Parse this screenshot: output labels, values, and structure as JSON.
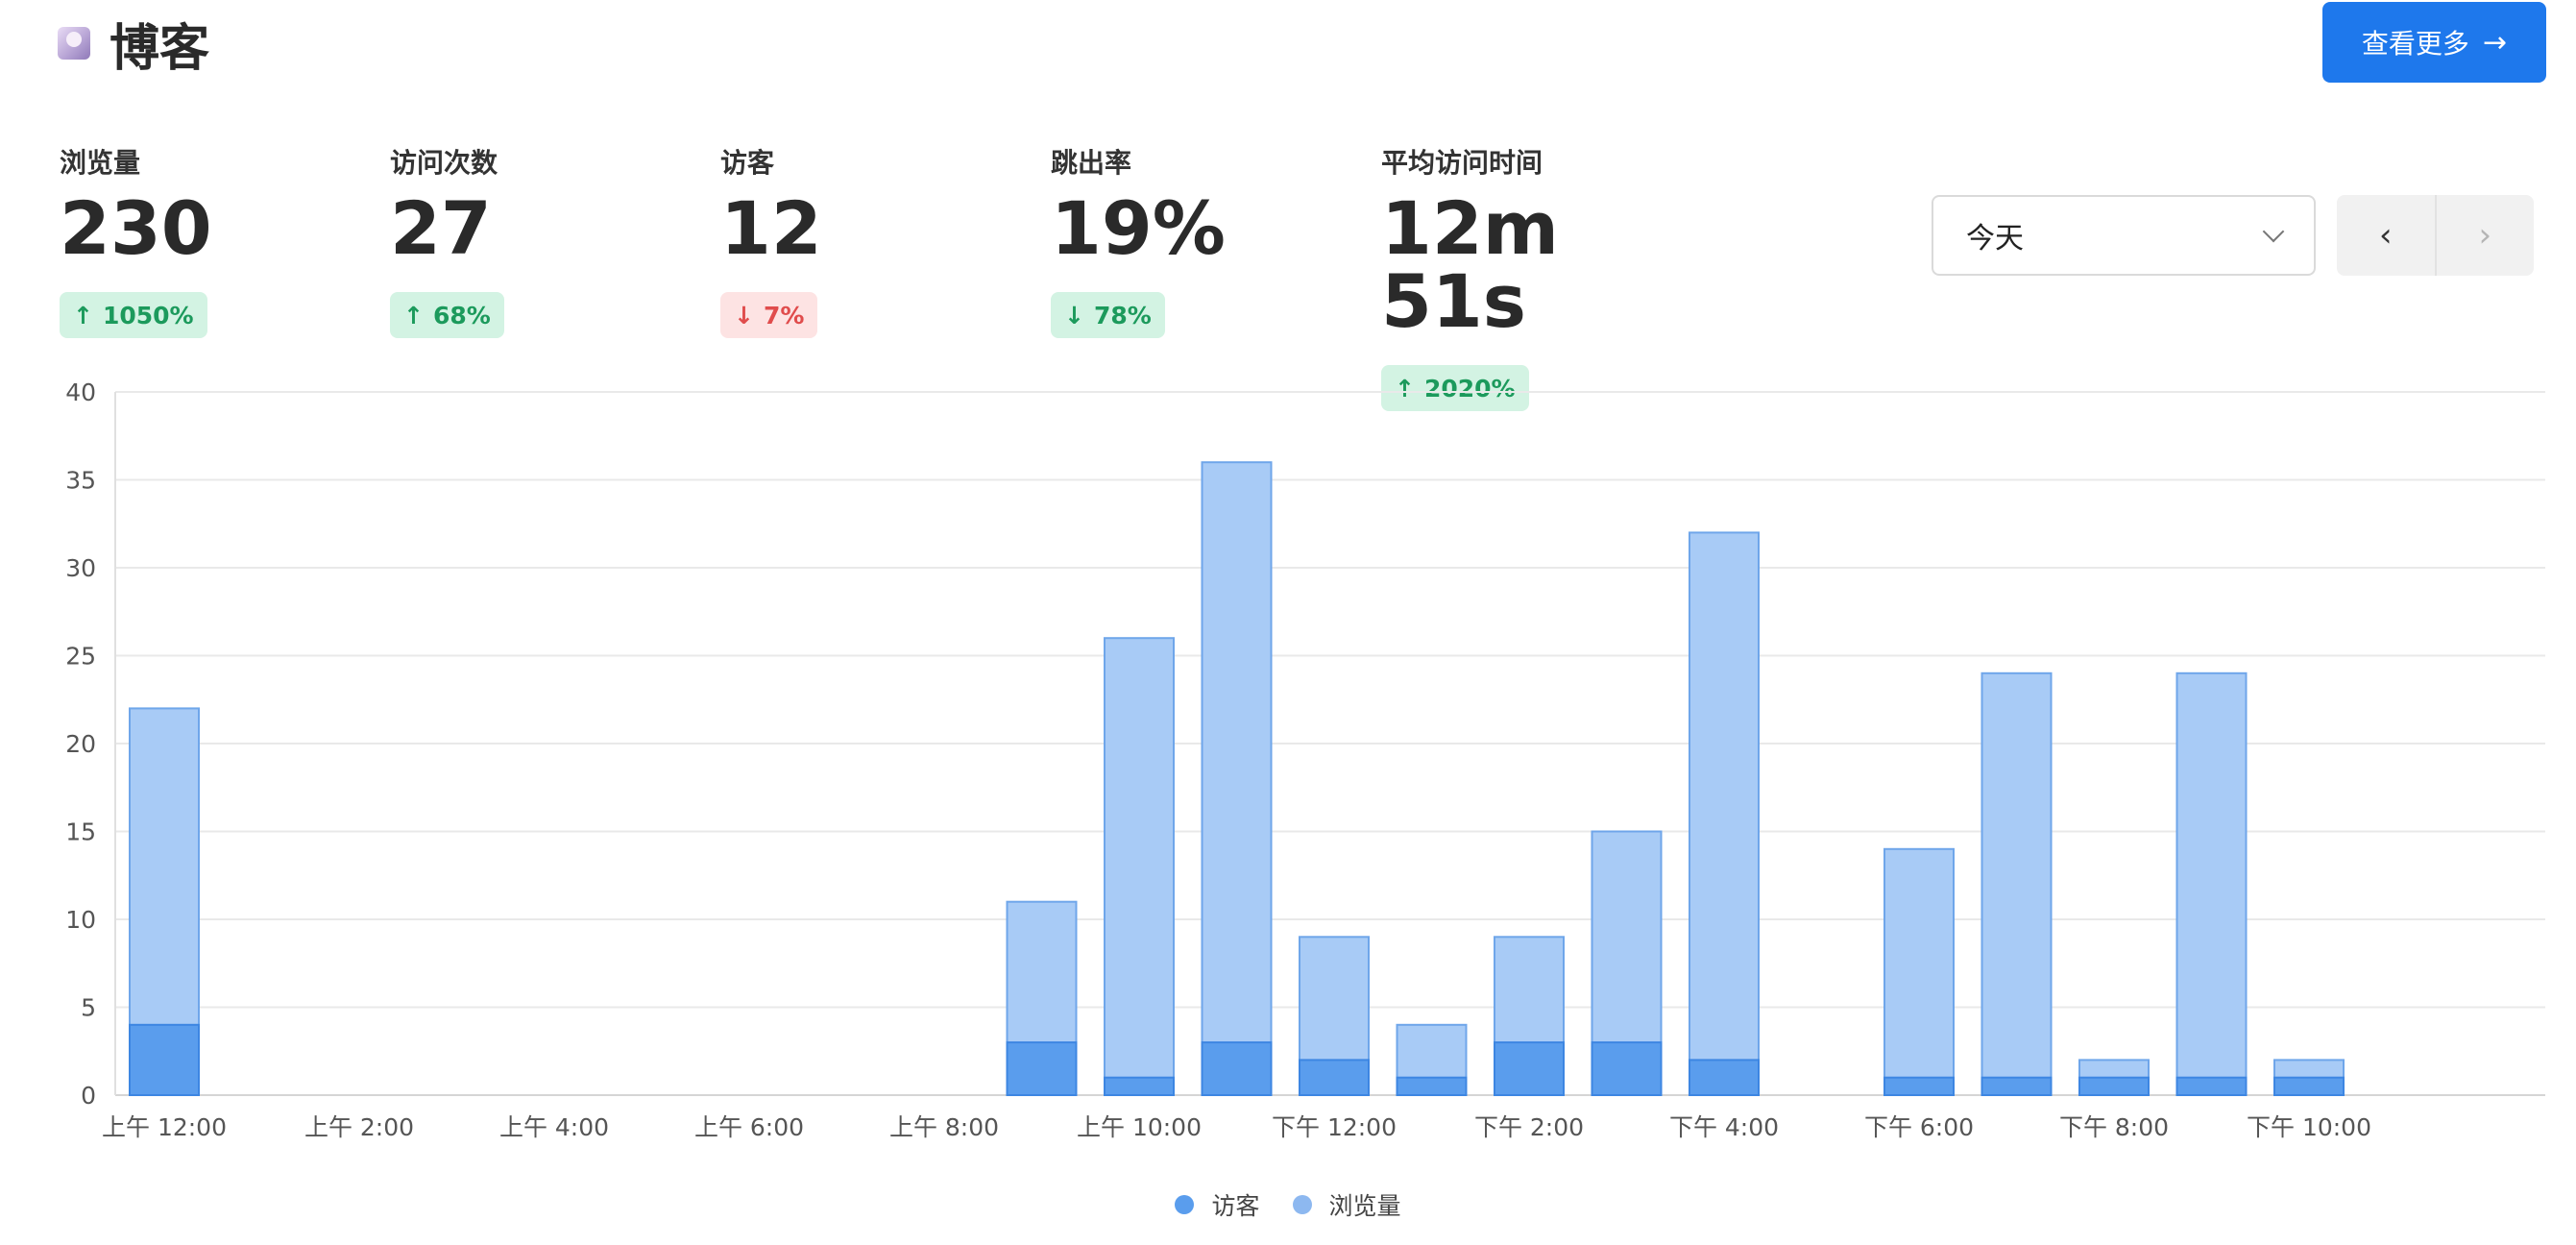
{
  "header": {
    "site_title": "博客",
    "view_more_label": "查看更多",
    "view_more_arrow": "→"
  },
  "metrics": [
    {
      "label": "浏览量",
      "value": "230",
      "change": "1050%",
      "direction": "up"
    },
    {
      "label": "访问次数",
      "value": "27",
      "change": "68%",
      "direction": "up"
    },
    {
      "label": "访客",
      "value": "12",
      "change": "7%",
      "direction": "down"
    },
    {
      "label": "跳出率",
      "value": "19%",
      "change": "78%",
      "direction": "down-good"
    },
    {
      "label": "平均访问时间",
      "value": "12m 51s",
      "change": "2020%",
      "direction": "up"
    }
  ],
  "controls": {
    "range_value": "今天",
    "prev_icon": "‹",
    "next_icon": "›"
  },
  "colors": {
    "accent": "#1e78ec",
    "visitors": "#5a9ded",
    "pageviews": "#a8cbf6",
    "positive": "#1c9a5c",
    "negative": "#e04c4c"
  },
  "chart_data": {
    "type": "bar",
    "stacked_overlay": true,
    "categories": [
      "上午 12:00",
      "上午 1:00",
      "上午 2:00",
      "上午 3:00",
      "上午 4:00",
      "上午 5:00",
      "上午 6:00",
      "上午 7:00",
      "上午 8:00",
      "上午 9:00",
      "上午 10:00",
      "上午 11:00",
      "下午 12:00",
      "下午 1:00",
      "下午 2:00",
      "下午 3:00",
      "下午 4:00",
      "下午 5:00",
      "下午 6:00",
      "下午 7:00",
      "下午 8:00",
      "下午 9:00",
      "下午 10:00",
      "下午 11:00"
    ],
    "x_tick_labels": [
      "上午 12:00",
      "上午 2:00",
      "上午 4:00",
      "上午 6:00",
      "上午 8:00",
      "上午 10:00",
      "下午 12:00",
      "下午 2:00",
      "下午 4:00",
      "下午 6:00",
      "下午 8:00",
      "下午 10:00"
    ],
    "series": [
      {
        "name": "访客",
        "values": [
          4,
          0,
          0,
          0,
          0,
          0,
          0,
          0,
          0,
          3,
          1,
          3,
          2,
          1,
          3,
          3,
          2,
          0,
          1,
          1,
          1,
          1,
          1,
          0
        ]
      },
      {
        "name": "浏览量",
        "values": [
          22,
          0,
          0,
          0,
          0,
          0,
          0,
          0,
          0,
          11,
          26,
          36,
          9,
          4,
          9,
          15,
          32,
          0,
          14,
          24,
          2,
          24,
          2,
          0
        ]
      }
    ],
    "ylim": [
      0,
      40
    ],
    "y_ticks": [
      0,
      5,
      10,
      15,
      20,
      25,
      30,
      35,
      40
    ],
    "grid": true,
    "legend": "bottom-center"
  }
}
